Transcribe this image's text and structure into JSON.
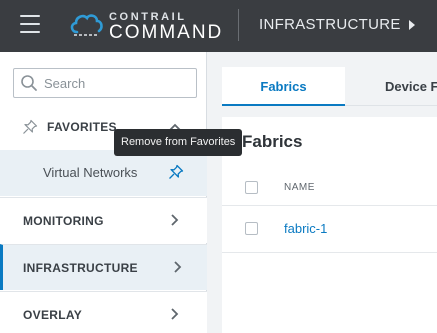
{
  "topbar": {
    "brand_top": "CONTRAIL",
    "brand_main": "COMMAND",
    "section": "INFRASTRUCTURE"
  },
  "sidebar": {
    "search_placeholder": "Search",
    "favorites": {
      "label": "FAVORITES",
      "items": [
        {
          "label": "Virtual Networks"
        }
      ]
    },
    "menu": [
      {
        "label": "MONITORING",
        "active": false
      },
      {
        "label": "INFRASTRUCTURE",
        "active": true
      },
      {
        "label": "OVERLAY",
        "active": false
      }
    ]
  },
  "tooltip": {
    "text": "Remove from Favorites"
  },
  "main": {
    "tabs": [
      {
        "label": "Fabrics",
        "active": true
      },
      {
        "label": "Device Fu",
        "active": false
      }
    ],
    "panel_title": "Fabrics",
    "table": {
      "columns": [
        "NAME"
      ],
      "rows": [
        {
          "name": "fabric-1"
        }
      ]
    }
  },
  "colors": {
    "topbar_bg": "#3a3d41",
    "accent": "#0a7ac2",
    "logo_cloud": "#2f9bd6"
  },
  "icons": [
    "hamburger-icon",
    "contrail-cloud-logo",
    "triangle-right-icon",
    "search-icon",
    "pin-icon",
    "chevron-up-icon",
    "chevron-right-icon"
  ]
}
